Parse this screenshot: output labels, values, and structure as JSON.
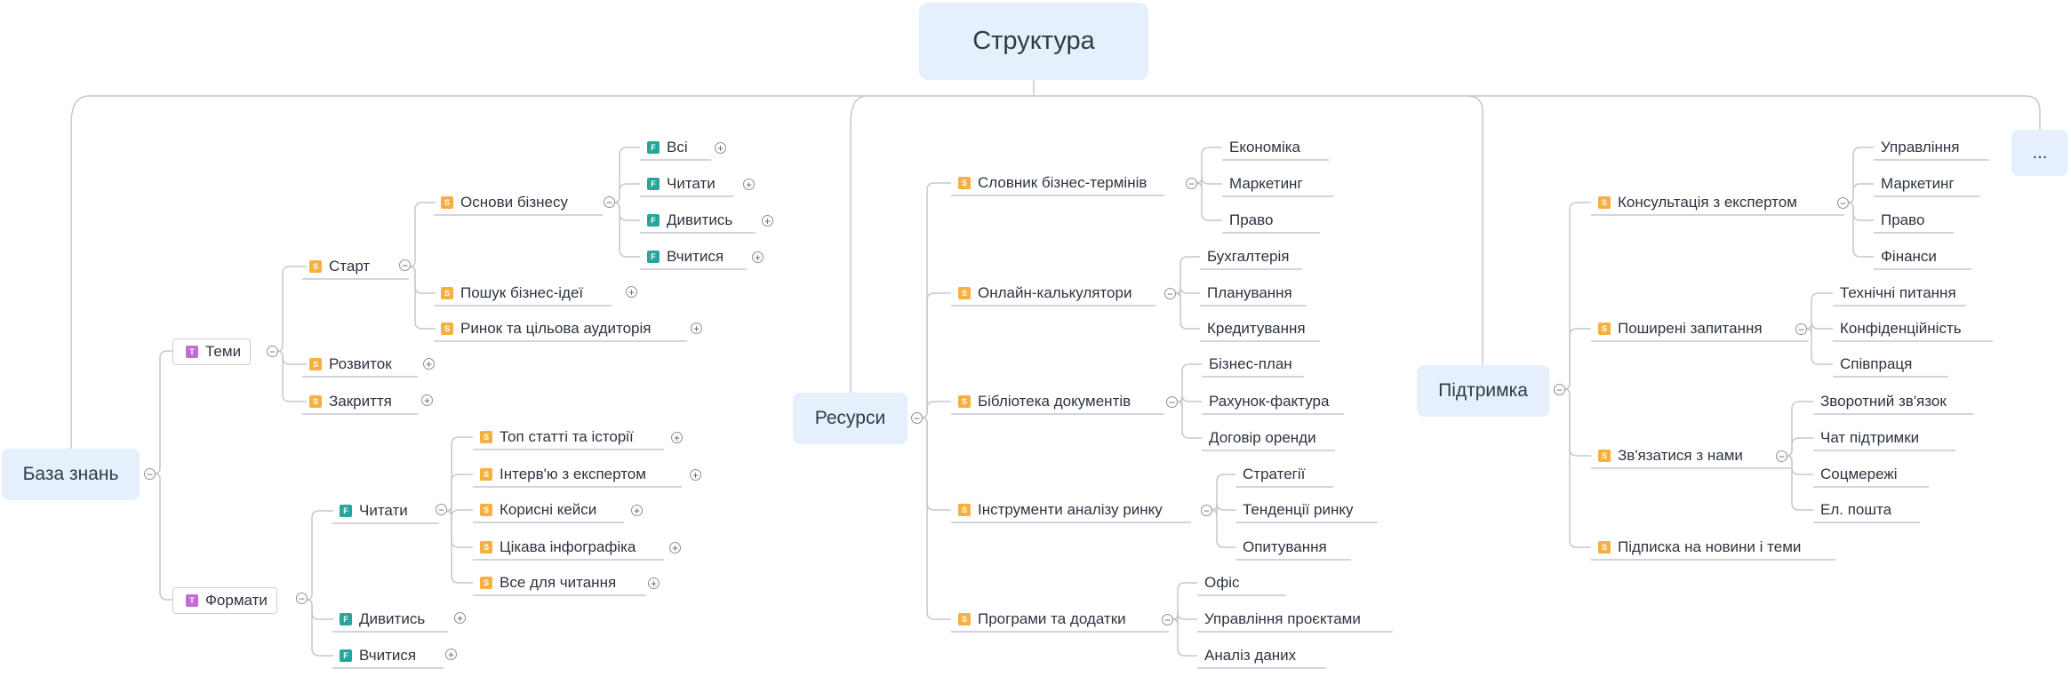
{
  "root": "Структура",
  "more_label": "...",
  "branches": {
    "kb": {
      "label": "База знань",
      "themes": {
        "label": "Теми",
        "badge": "T",
        "start": {
          "label": "Старт",
          "badge": "S",
          "basics": {
            "label": "Основи бізнесу",
            "badge": "S",
            "items": [
              {
                "label": "Всі",
                "badge": "F"
              },
              {
                "label": "Читати",
                "badge": "F"
              },
              {
                "label": "Дивитись",
                "badge": "F"
              },
              {
                "label": "Вчитися",
                "badge": "F"
              }
            ]
          },
          "idea": {
            "label": "Пошук бізнес-ідеї",
            "badge": "S"
          },
          "market": {
            "label": "Ринок та цільова аудиторія",
            "badge": "S"
          }
        },
        "growth": {
          "label": "Розвиток",
          "badge": "S"
        },
        "closing": {
          "label": "Закриття",
          "badge": "S"
        }
      },
      "formats": {
        "label": "Формати",
        "badge": "T",
        "read": {
          "label": "Читати",
          "badge": "F",
          "items": [
            {
              "label": "Топ статті та історії",
              "badge": "S"
            },
            {
              "label": "Інтерв'ю з експертом",
              "badge": "S"
            },
            {
              "label": "Корисні кейси",
              "badge": "S"
            },
            {
              "label": "Цікава інфографіка",
              "badge": "S"
            },
            {
              "label": "Все для читання",
              "badge": "S"
            }
          ]
        },
        "watch": {
          "label": "Дивитись",
          "badge": "F"
        },
        "learn": {
          "label": "Вчитися",
          "badge": "F"
        }
      }
    },
    "res": {
      "label": "Ресурси",
      "groups": [
        {
          "label": "Словник бізнес-термінів",
          "badge": "S",
          "items": [
            "Економіка",
            "Маркетинг",
            "Право"
          ]
        },
        {
          "label": "Онлайн-калькулятори",
          "badge": "S",
          "items": [
            "Бухгалтерія",
            "Планування",
            "Кредитування"
          ]
        },
        {
          "label": "Бібліотека документів",
          "badge": "S",
          "items": [
            "Бізнес-план",
            "Рахунок-фактура",
            "Договір оренди"
          ]
        },
        {
          "label": "Інструменти аналізу ринку",
          "badge": "S",
          "items": [
            "Стратегії",
            "Тенденції ринку",
            "Опитування"
          ]
        },
        {
          "label": "Програми та додатки",
          "badge": "S",
          "items": [
            "Офіс",
            "Управління проєктами",
            "Аналіз даних"
          ]
        }
      ]
    },
    "sup": {
      "label": "Підтримка",
      "groups": [
        {
          "label": "Консультація з експертом",
          "badge": "S",
          "items": [
            "Управління",
            "Маркетинг",
            "Право",
            "Фінанси"
          ]
        },
        {
          "label": "Поширені запитання",
          "badge": "S",
          "items": [
            "Технічні питання",
            "Конфіденційність",
            "Співпраця"
          ]
        },
        {
          "label": "Зв'язатися з нами",
          "badge": "S",
          "items": [
            "Зворотний зв'язок",
            "Чат підтримки",
            "Соцмережі",
            "Ел. пошта"
          ]
        },
        {
          "label": "Підписка на новини і теми",
          "badge": "S",
          "items": []
        }
      ]
    }
  },
  "controls": {
    "collapse": "−",
    "expand": "+"
  }
}
